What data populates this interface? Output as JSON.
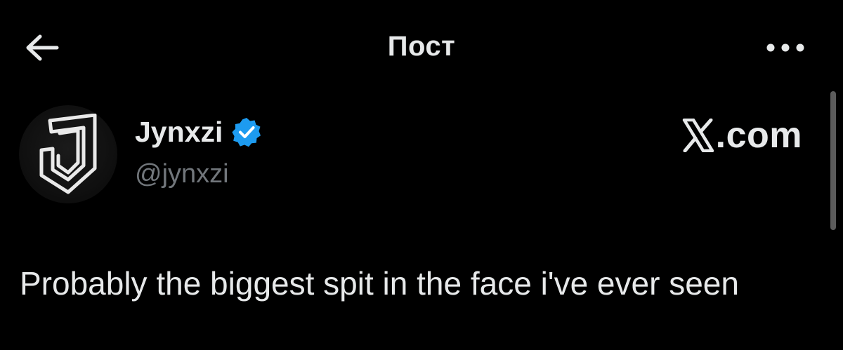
{
  "header": {
    "title": "Пост",
    "back_icon": "arrow-left-icon",
    "more_icon": "ellipsis-icon"
  },
  "author": {
    "display_name": "Jynxzi",
    "handle": "@jynxzi",
    "verified": true,
    "verified_color": "#1d9bf0",
    "avatar_icon": "jynxzi-logo"
  },
  "brand": {
    "domain": "X.com",
    "domain_suffix": ".com"
  },
  "post": {
    "text": "Probably the biggest spit in the face i've ever seen"
  },
  "colors": {
    "background": "#000000",
    "primary_text": "#e7e9ea",
    "secondary_text": "#71767b",
    "verified": "#1d9bf0"
  }
}
